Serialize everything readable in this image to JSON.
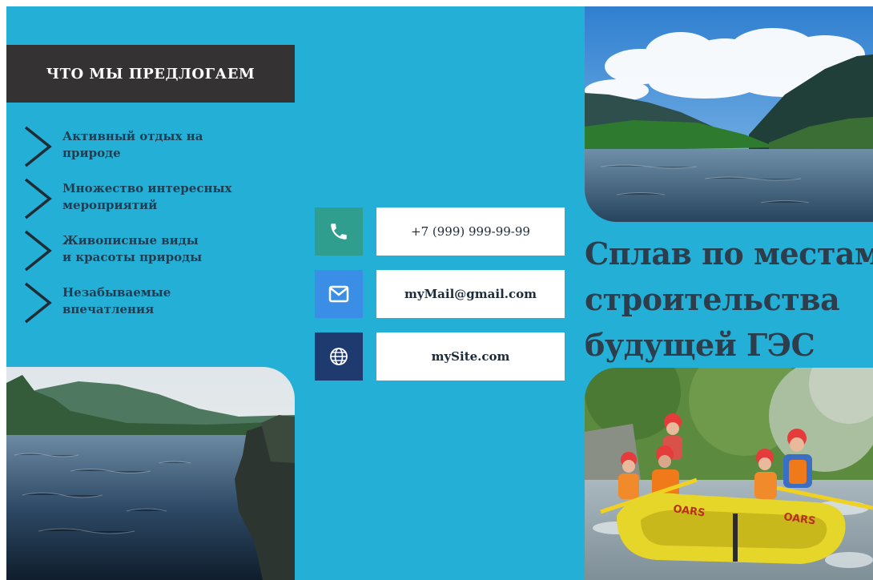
{
  "offer": {
    "title": "ЧТО МЫ ПРЕДЛОГАЕМ",
    "items": [
      {
        "line1": "Активный отдых на",
        "line2": "природе"
      },
      {
        "line1": "Множество интересных",
        "line2": "мероприятий"
      },
      {
        "line1": "Живописные виды",
        "line2": "и красоты природы"
      },
      {
        "line1": "Незабываемые",
        "line2": "впечатления"
      }
    ]
  },
  "contacts": {
    "phone": "+7 (999) 999-99-99",
    "email": "myMail@gmail.com",
    "site": "mySite.com",
    "phone_icon": "phone-icon",
    "email_icon": "mail-icon",
    "site_icon": "globe-icon"
  },
  "headline": {
    "line1": "Сплав по местам",
    "line2": "строительства",
    "line3": "будущей ГЭС"
  },
  "colors": {
    "background": "#24b0d6",
    "header_bg": "#343233",
    "text_dark": "#2e3d4b",
    "phone_icon_bg": "#2f9e8f",
    "email_icon_bg": "#3a8ee6",
    "site_icon_bg": "#1f3a6e"
  }
}
